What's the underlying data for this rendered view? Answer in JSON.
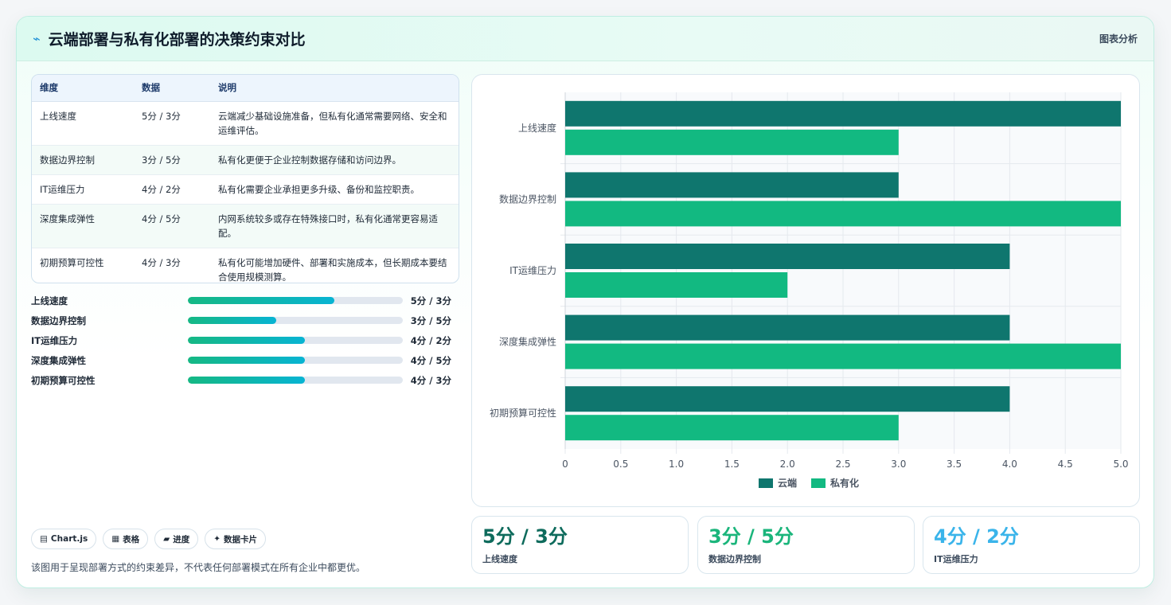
{
  "header": {
    "logo_icon": "⌁",
    "title": "云端部署与私有化部署的决策约束对比",
    "tag": "图表分析"
  },
  "table": {
    "headers": [
      "维度",
      "数据",
      "说明"
    ],
    "rows": [
      {
        "dim": "上线速度",
        "data": "5分 / 3分",
        "desc": "云端减少基础设施准备，但私有化通常需要网络、安全和运维评估。"
      },
      {
        "dim": "数据边界控制",
        "data": "3分 / 5分",
        "desc": "私有化更便于企业控制数据存储和访问边界。"
      },
      {
        "dim": "IT运维压力",
        "data": "4分 / 2分",
        "desc": "私有化需要企业承担更多升级、备份和监控职责。"
      },
      {
        "dim": "深度集成弹性",
        "data": "4分 / 5分",
        "desc": "内网系统较多或存在特殊接口时，私有化通常更容易适配。"
      },
      {
        "dim": "初期预算可控性",
        "data": "4分 / 3分",
        "desc": "私有化可能增加硬件、部署和实施成本，但长期成本要结合使用规模测算。"
      }
    ]
  },
  "progress": [
    {
      "label": "上线速度",
      "value": "5分 / 3分",
      "fraction": 0.68
    },
    {
      "label": "数据边界控制",
      "value": "3分 / 5分",
      "fraction": 0.41
    },
    {
      "label": "IT运维压力",
      "value": "4分 / 2分",
      "fraction": 0.545
    },
    {
      "label": "深度集成弹性",
      "value": "4分 / 5分",
      "fraction": 0.545
    },
    {
      "label": "初期预算可控性",
      "value": "4分 / 3分",
      "fraction": 0.545
    }
  ],
  "chips": [
    {
      "icon": "▤",
      "label": "Chart.js"
    },
    {
      "icon": "▦",
      "label": "表格"
    },
    {
      "icon": "▰",
      "label": "进度"
    },
    {
      "icon": "✦",
      "label": "数据卡片"
    }
  ],
  "note": "该图用于呈现部署方式的约束差异，不代表任何部署模式在所有企业中都更优。",
  "stats": [
    {
      "value": "5分 / 3分",
      "label": "上线速度",
      "color": "#0e6b5c"
    },
    {
      "value": "3分 / 5分",
      "label": "数据边界控制",
      "color": "#1ab57b"
    },
    {
      "value": "4分 / 2分",
      "label": "IT运维压力",
      "color": "#3ab4ea"
    }
  ],
  "chart_data": {
    "type": "bar",
    "orientation": "horizontal",
    "categories": [
      "上线速度",
      "数据边界控制",
      "IT运维压力",
      "深度集成弹性",
      "初期预算可控性"
    ],
    "series": [
      {
        "name": "云端",
        "values": [
          5,
          3,
          4,
          4,
          4
        ],
        "color": "#0f766e"
      },
      {
        "name": "私有化",
        "values": [
          3,
          5,
          2,
          5,
          3
        ],
        "color": "#12b981"
      }
    ],
    "xlim": [
      0,
      5
    ],
    "xticks": [
      "0",
      "0.5",
      "1.0",
      "1.5",
      "2.0",
      "2.5",
      "3.0",
      "3.5",
      "4.0",
      "4.5",
      "5.0"
    ],
    "grid": true,
    "legend": "bottom"
  }
}
